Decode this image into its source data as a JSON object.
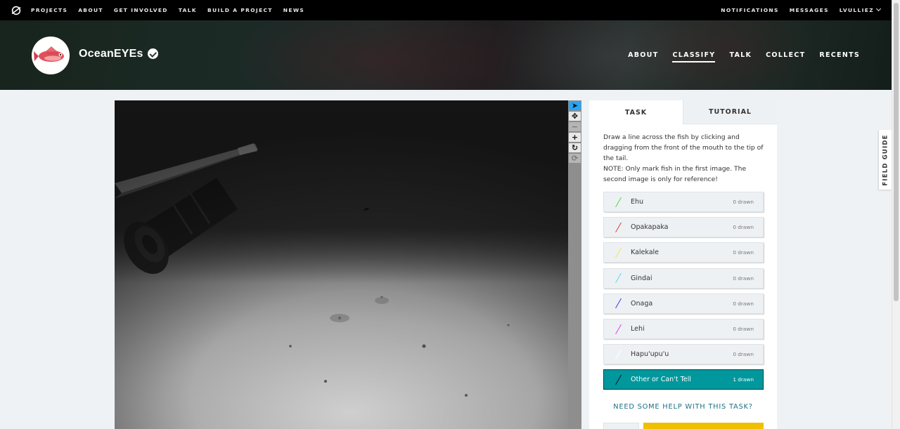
{
  "topnav": {
    "logo_icon": "zooniverse-logo-icon",
    "left_links": [
      "PROJECTS",
      "ABOUT",
      "GET INVOLVED",
      "TALK",
      "BUILD A PROJECT",
      "NEWS"
    ],
    "right_links": [
      "NOTIFICATIONS",
      "MESSAGES"
    ],
    "user": "LVULLIEZ"
  },
  "project": {
    "title": "OceanEYEs",
    "verified_icon": "verified-badge-icon",
    "nav": [
      "ABOUT",
      "CLASSIFY",
      "TALK",
      "COLLECT",
      "RECENTS"
    ],
    "active_nav": "CLASSIFY"
  },
  "viewer_tools": [
    {
      "name": "pointer-tool-icon",
      "glyph": "➤",
      "state": "active"
    },
    {
      "name": "move-tool-icon",
      "glyph": "✥",
      "state": "normal"
    },
    {
      "name": "zoom-out-icon",
      "glyph": "−",
      "state": "disabled"
    },
    {
      "name": "zoom-in-icon",
      "glyph": "+",
      "state": "normal"
    },
    {
      "name": "rotate-icon",
      "glyph": "↻",
      "state": "normal"
    },
    {
      "name": "reset-icon",
      "glyph": "⟳",
      "state": "disabled"
    }
  ],
  "panel": {
    "tabs": {
      "task": "TASK",
      "tutorial": "TUTORIAL"
    },
    "instructions": [
      "Draw a line across the fish by clicking and dragging from the front of the mouth to the tip of the tail.",
      "NOTE: Only mark fish in the first image. The second image is only for reference!"
    ],
    "tools": [
      {
        "label": "Ehu",
        "count": "0 drawn",
        "color": "#4fd84a",
        "selected": false
      },
      {
        "label": "Opakapaka",
        "count": "0 drawn",
        "color": "#e03a3a",
        "selected": false
      },
      {
        "label": "Kalekale",
        "count": "0 drawn",
        "color": "#f2e64e",
        "selected": false
      },
      {
        "label": "Gindai",
        "count": "0 drawn",
        "color": "#55d9f0",
        "selected": false
      },
      {
        "label": "Onaga",
        "count": "0 drawn",
        "color": "#3a3adf",
        "selected": false
      },
      {
        "label": "Lehi",
        "count": "0 drawn",
        "color": "#e63ce0",
        "selected": false
      },
      {
        "label": "Hapu'upu'u",
        "count": "0 drawn",
        "color": "#ffffff",
        "selected": false
      },
      {
        "label": "Other or Can't Tell",
        "count": "1 drawn",
        "color": "#111111",
        "selected": true
      }
    ],
    "help_link": "NEED SOME HELP WITH THIS TASK?"
  },
  "field_guide": "FIELD GUIDE"
}
